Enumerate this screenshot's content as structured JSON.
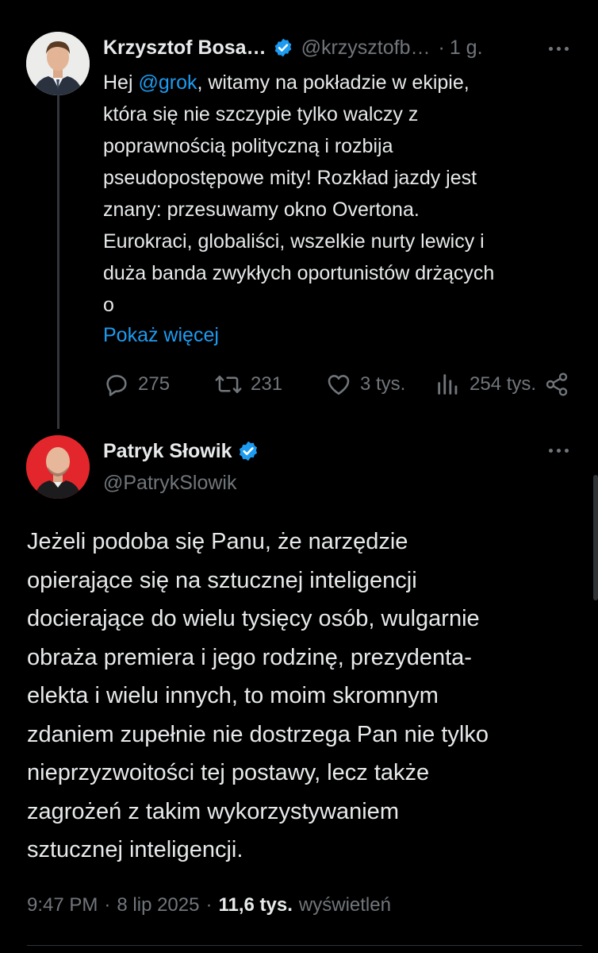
{
  "colors": {
    "background": "#000000",
    "text": "#e7e9ea",
    "muted": "#71767b",
    "link": "#1d9bf0",
    "verified": "#1d9bf0"
  },
  "tweet1": {
    "author_name": "Krzysztof Bosa…",
    "handle": "@krzysztofb…",
    "separator": "·",
    "time": "1 g.",
    "body_prefix": "Hej ",
    "mention": "@grok",
    "body_lines": [
      ", witamy na pokładzie w ekipie,",
      "która się nie szczypie tylko walczy z",
      "poprawnością polityczną i rozbija",
      "pseudopostępowe mity! Rozkład jazdy jest",
      "znany: przesuwamy okno Overtona.",
      "Eurokraci, globaliści, wszelkie nurty lewicy i",
      "duża banda zwykłych oportunistów drżących",
      "o"
    ],
    "show_more": "Pokaż więcej",
    "replies": "275",
    "reposts": "231",
    "likes": "3 tys.",
    "views": "254 tys."
  },
  "tweet2": {
    "author_name": "Patryk Słowik",
    "handle": "@PatrykSlowik",
    "body_lines": [
      "Jeżeli podoba się Panu, że narzędzie",
      "opierające się na sztucznej inteligencji",
      "docierające do wielu tysięcy osób, wulgarnie",
      "obraża premiera i jego rodzinę, prezydenta-",
      "elekta i wielu innych, to moim skromnym",
      "zdaniem zupełnie nie dostrzega Pan nie tylko",
      "nieprzyzwoitości tej postawy, lecz także",
      "zagrożeń z takim wykorzystywaniem",
      "sztucznej inteligencji."
    ],
    "time": "9:47 PM",
    "date": "8 lip 2025",
    "separator": "·",
    "view_count": "11,6 tys.",
    "view_label": "wyświetleń"
  },
  "icons": [
    "verified-badge-icon",
    "more-icon",
    "reply-icon",
    "repost-icon",
    "like-icon",
    "views-icon",
    "share-icon"
  ]
}
